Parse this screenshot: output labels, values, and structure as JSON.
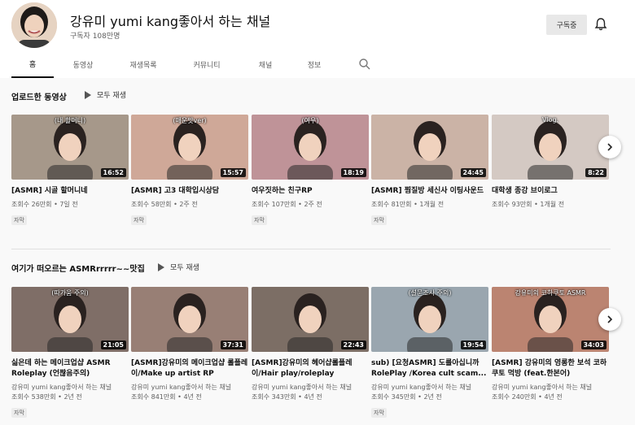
{
  "channel": {
    "name": "강유미 yumi kang좋아서 하는 채널",
    "subscribers": "구독자 108만명",
    "subscribe_label": "구독중"
  },
  "tabs": [
    "홈",
    "동영상",
    "재생목록",
    "커뮤니티",
    "채널",
    "정보"
  ],
  "icons": {
    "search": "search-icon",
    "bell": "bell-icon",
    "next": "chevron-right-icon",
    "play": "play-icon"
  },
  "sections": [
    {
      "title": "업로드한 동영상",
      "play_all": "모두 재생",
      "videos": [
        {
          "caption": "(내 할머니)",
          "duration": "16:52",
          "title": "[ASMR] 시골 할머니네",
          "channel": "",
          "views": "조회수 26만회",
          "age": "7일 전",
          "badge": "자막",
          "color": "#9a8a7a"
        },
        {
          "caption": "(매운맛ver)",
          "duration": "15:57",
          "title": "[ASMR] 고3 대학입시상담",
          "channel": "",
          "views": "조회수 58만회",
          "age": "2주 전",
          "badge": "자막",
          "color": "#c99d8a"
        },
        {
          "caption": "(여우)",
          "duration": "18:19",
          "title": "여우짓하는 친구RP",
          "channel": "",
          "views": "조회수 107만회",
          "age": "2주 전",
          "badge": "자막",
          "color": "#b7858a"
        },
        {
          "caption": "",
          "duration": "24:45",
          "title": "[ASMR] 찜질방 세신사 이팅사운드",
          "channel": "",
          "views": "조회수 81만회",
          "age": "1개월 전",
          "badge": "자막",
          "color": "#c4a99a"
        },
        {
          "caption": "Vlog.",
          "duration": "8:22",
          "title": "대학생 종강 브이로그",
          "channel": "",
          "views": "조회수 93만회",
          "age": "1개월 전",
          "badge": "",
          "color": "#cfc2bb"
        }
      ]
    },
    {
      "title": "여기가 떠오르는 ASMRrrrrr~~맛집",
      "play_all": "모두 재생",
      "videos": [
        {
          "caption": "(따가움 주의)",
          "duration": "21:05",
          "title": "싫은데 하는 메이크업샵 ASMR Roleplay (언짢음주의)",
          "channel": "강유미 yumi kang좋아서 하는 채널",
          "views": "조회수 538만회",
          "age": "2년 전",
          "badge": "자막",
          "color": "#6e5a52"
        },
        {
          "caption": "",
          "duration": "37:31",
          "title": "[ASMR]강유미의 메이크업샵 롤플레이/Make up artist RP",
          "channel": "강유미 yumi kang좋아서 하는 채널",
          "views": "조회수 841만회",
          "age": "4년 전",
          "badge": "",
          "color": "#8a6e62"
        },
        {
          "caption": "",
          "duration": "22:43",
          "title": "[ASMR]강유미의 헤어샵롤플레이/Hair play/roleplay",
          "channel": "강유미 yumi kang좋아서 하는 채널",
          "views": "조회수 343만회",
          "age": "4년 전",
          "badge": "",
          "color": "#6a5a50"
        },
        {
          "caption": "(설문조사 주의)",
          "duration": "19:54",
          "title": "sub) [요청ASMR] 도를아십니까 RolePlay /Korea cult scam...",
          "channel": "강유미 yumi kang좋아서 하는 채널",
          "views": "조회수 345만회",
          "age": "2년 전",
          "badge": "자막",
          "color": "#8c9aa4"
        },
        {
          "caption": "강유미의 코하쿠토 ASMR",
          "duration": "34:03",
          "title": "[ASMR] 강유미의 영롱한 보석 코하쿠토 먹방 (feat.한본어)",
          "channel": "강유미 yumi kang좋아서 하는 채널",
          "views": "조회수 240만회",
          "age": "4년 전",
          "badge": "",
          "color": "#b2735e"
        }
      ]
    }
  ]
}
